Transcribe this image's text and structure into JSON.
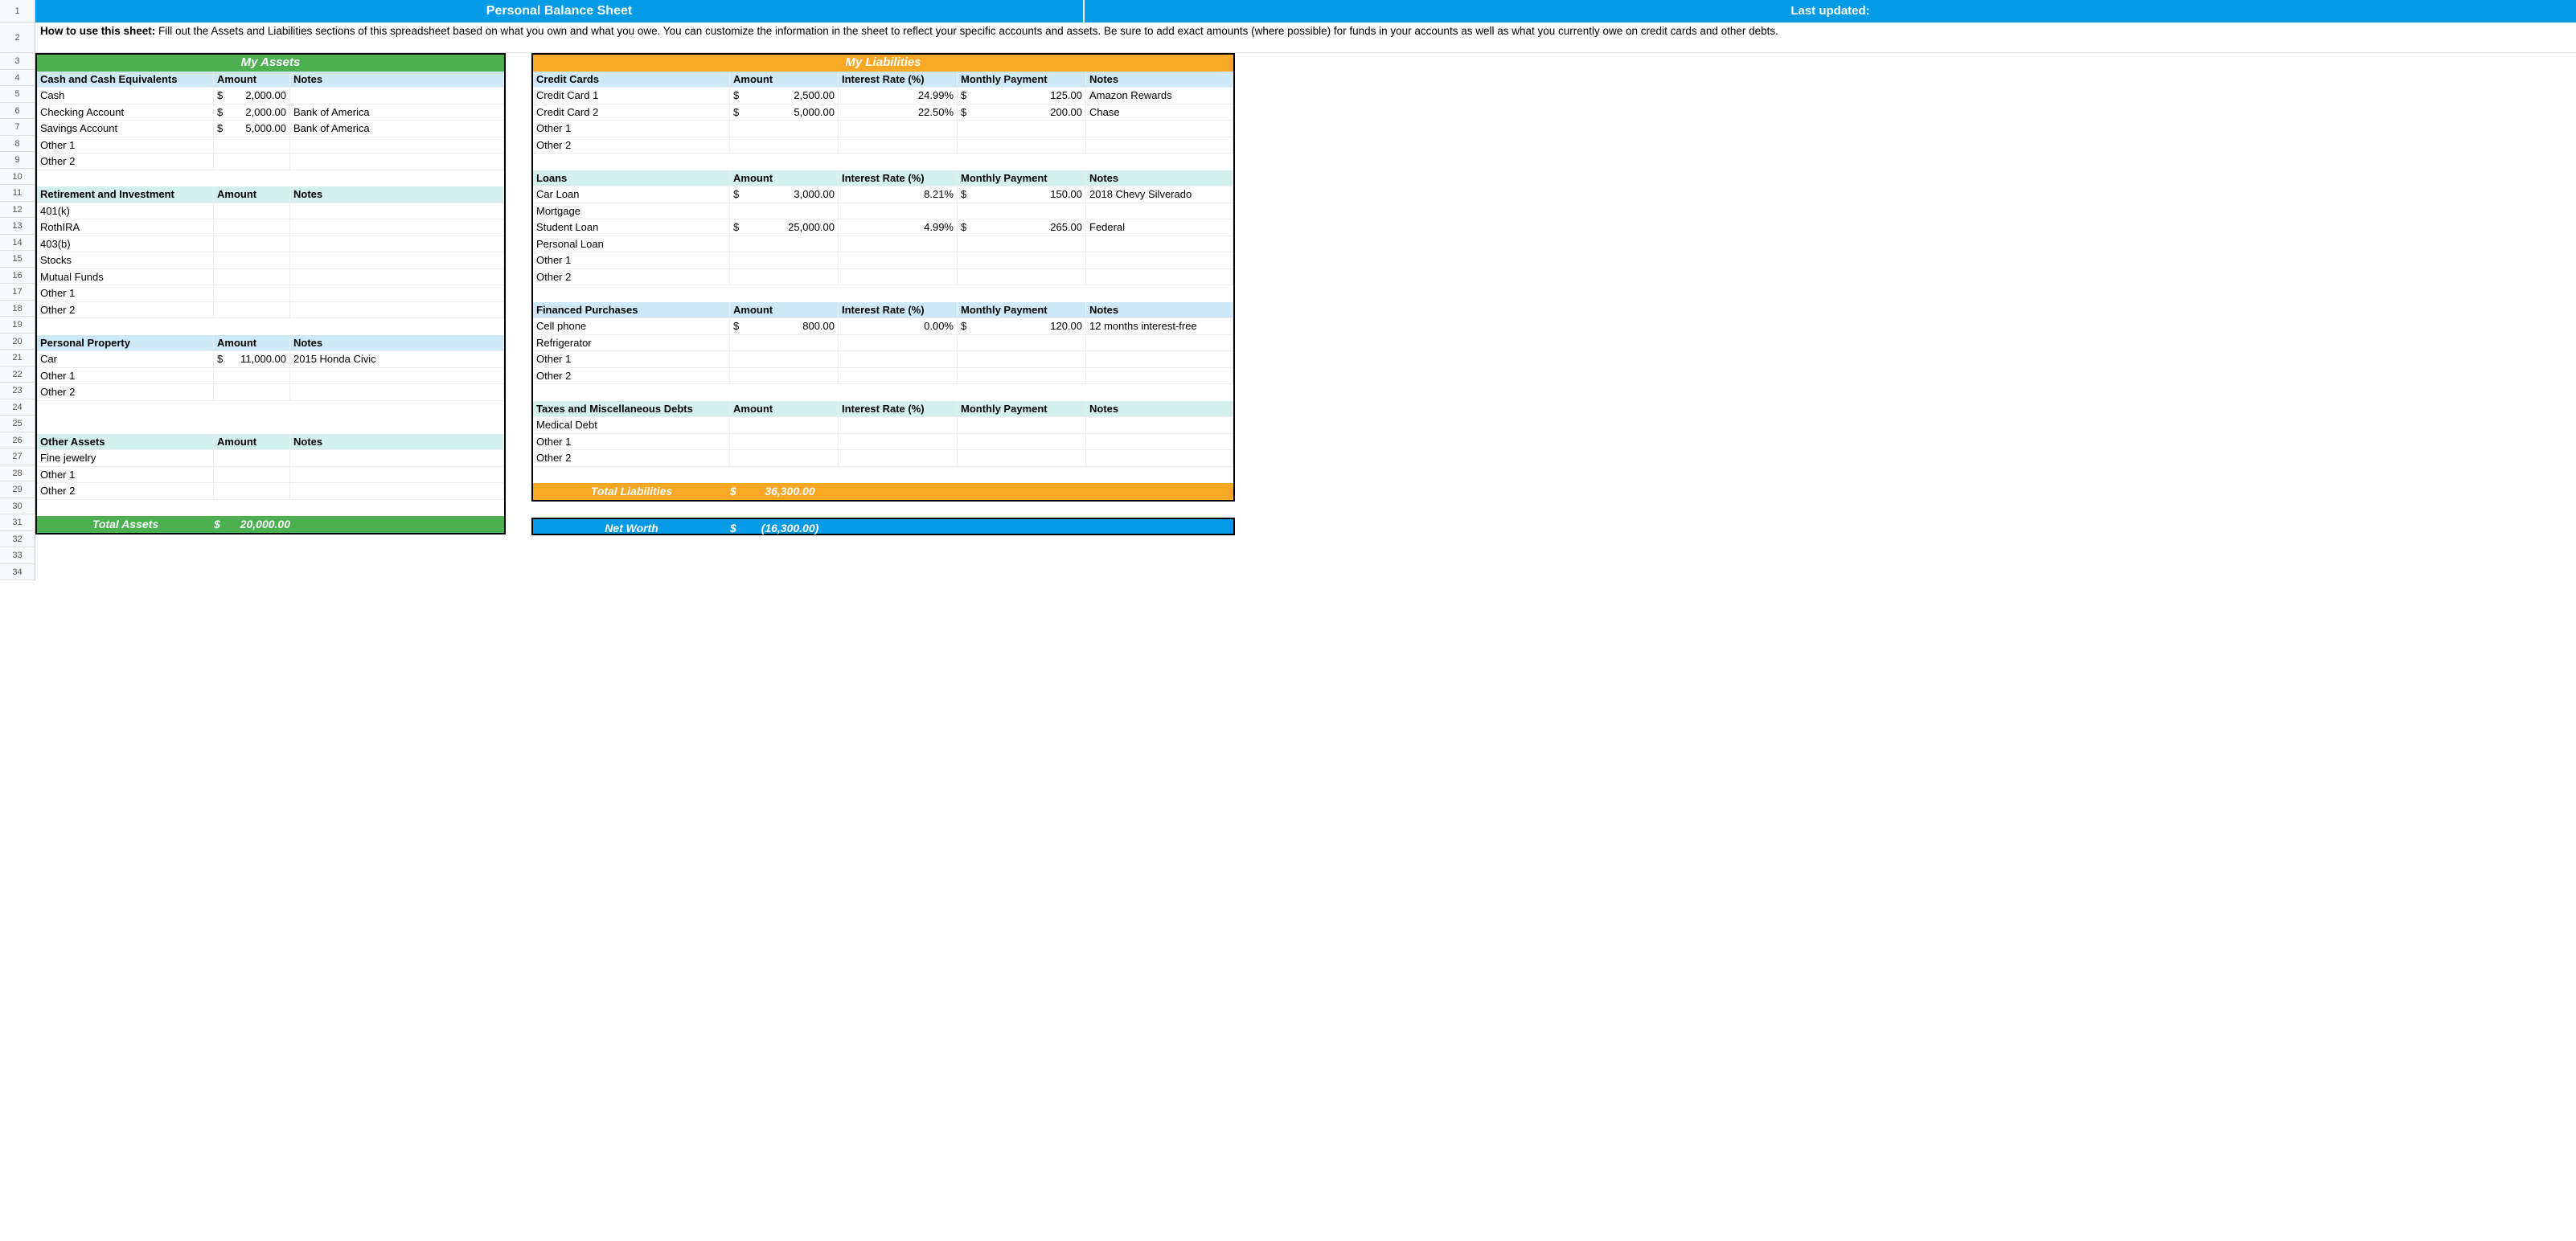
{
  "title": "Personal Balance Sheet",
  "lastUpdatedLabel": "Last updated:",
  "introBold": "How to use this sheet:",
  "introText": " Fill out the Assets and Liabilities sections of this spreadsheet based on what you own and what you owe. You can customize the information in the sheet to reflect your specific accounts and assets. Be sure to add exact amounts (where possible) for funds in your accounts as well as what you currently owe on credit cards and other debts.",
  "assetsTitle": "My Assets",
  "liabTitle": "My Liabilities",
  "colAmount": "Amount",
  "colNotes": "Notes",
  "colRate": "Interest Rate (%)",
  "colPay": "Monthly Payment",
  "assets": {
    "cash": {
      "header": "Cash and Cash Equivalents",
      "rows": [
        {
          "name": "Cash",
          "cur": "$",
          "amt": "2,000.00",
          "notes": ""
        },
        {
          "name": "Checking Account",
          "cur": "$",
          "amt": "2,000.00",
          "notes": "Bank of America"
        },
        {
          "name": "Savings Account",
          "cur": "$",
          "amt": "5,000.00",
          "notes": "Bank of America"
        },
        {
          "name": "Other 1",
          "cur": "",
          "amt": "",
          "notes": ""
        },
        {
          "name": "Other 2",
          "cur": "",
          "amt": "",
          "notes": ""
        }
      ]
    },
    "retire": {
      "header": "Retirement and Investment",
      "rows": [
        {
          "name": "401(k)",
          "cur": "",
          "amt": "",
          "notes": ""
        },
        {
          "name": "RothIRA",
          "cur": "",
          "amt": "",
          "notes": ""
        },
        {
          "name": "403(b)",
          "cur": "",
          "amt": "",
          "notes": ""
        },
        {
          "name": "Stocks",
          "cur": "",
          "amt": "",
          "notes": ""
        },
        {
          "name": "Mutual Funds",
          "cur": "",
          "amt": "",
          "notes": ""
        },
        {
          "name": "Other 1",
          "cur": "",
          "amt": "",
          "notes": ""
        },
        {
          "name": "Other 2",
          "cur": "",
          "amt": "",
          "notes": ""
        }
      ]
    },
    "prop": {
      "header": "Personal Property",
      "rows": [
        {
          "name": "Car",
          "cur": "$",
          "amt": "11,000.00",
          "notes": "2015 Honda Civic"
        },
        {
          "name": "Other 1",
          "cur": "",
          "amt": "",
          "notes": ""
        },
        {
          "name": "Other 2",
          "cur": "",
          "amt": "",
          "notes": ""
        }
      ]
    },
    "other": {
      "header": "Other Assets",
      "rows": [
        {
          "name": "Fine jewelry",
          "cur": "",
          "amt": "",
          "notes": ""
        },
        {
          "name": "Other 1",
          "cur": "",
          "amt": "",
          "notes": ""
        },
        {
          "name": "Other 2",
          "cur": "",
          "amt": "",
          "notes": ""
        }
      ]
    }
  },
  "liab": {
    "cc": {
      "header": "Credit Cards",
      "rows": [
        {
          "name": "Credit Card 1",
          "cur": "$",
          "amt": "2,500.00",
          "rate": "24.99%",
          "pcur": "$",
          "pay": "125.00",
          "notes": "Amazon Rewards"
        },
        {
          "name": "Credit Card 2",
          "cur": "$",
          "amt": "5,000.00",
          "rate": "22.50%",
          "pcur": "$",
          "pay": "200.00",
          "notes": "Chase"
        },
        {
          "name": "Other 1",
          "cur": "",
          "amt": "",
          "rate": "",
          "pcur": "",
          "pay": "",
          "notes": ""
        },
        {
          "name": "Other 2",
          "cur": "",
          "amt": "",
          "rate": "",
          "pcur": "",
          "pay": "",
          "notes": ""
        }
      ]
    },
    "loans": {
      "header": "Loans",
      "rows": [
        {
          "name": "Car Loan",
          "cur": "$",
          "amt": "3,000.00",
          "rate": "8.21%",
          "pcur": "$",
          "pay": "150.00",
          "notes": "2018 Chevy Silverado"
        },
        {
          "name": "Mortgage",
          "cur": "",
          "amt": "",
          "rate": "",
          "pcur": "",
          "pay": "",
          "notes": ""
        },
        {
          "name": "Student Loan",
          "cur": "$",
          "amt": "25,000.00",
          "rate": "4.99%",
          "pcur": "$",
          "pay": "265.00",
          "notes": "Federal"
        },
        {
          "name": "Personal Loan",
          "cur": "",
          "amt": "",
          "rate": "",
          "pcur": "",
          "pay": "",
          "notes": ""
        },
        {
          "name": "Other 1",
          "cur": "",
          "amt": "",
          "rate": "",
          "pcur": "",
          "pay": "",
          "notes": ""
        },
        {
          "name": "Other 2",
          "cur": "",
          "amt": "",
          "rate": "",
          "pcur": "",
          "pay": "",
          "notes": ""
        }
      ]
    },
    "fin": {
      "header": "Financed Purchases",
      "rows": [
        {
          "name": "Cell phone",
          "cur": "$",
          "amt": "800.00",
          "rate": "0.00%",
          "pcur": "$",
          "pay": "120.00",
          "notes": "12 months interest-free"
        },
        {
          "name": "Refrigerator",
          "cur": "",
          "amt": "",
          "rate": "",
          "pcur": "",
          "pay": "",
          "notes": ""
        },
        {
          "name": "Other 1",
          "cur": "",
          "amt": "",
          "rate": "",
          "pcur": "",
          "pay": "",
          "notes": ""
        },
        {
          "name": "Other 2",
          "cur": "",
          "amt": "",
          "rate": "",
          "pcur": "",
          "pay": "",
          "notes": ""
        }
      ]
    },
    "tax": {
      "header": "Taxes and Miscellaneous Debts",
      "rows": [
        {
          "name": "Medical Debt",
          "cur": "",
          "amt": "",
          "rate": "",
          "pcur": "",
          "pay": "",
          "notes": ""
        },
        {
          "name": "Other 1",
          "cur": "",
          "amt": "",
          "rate": "",
          "pcur": "",
          "pay": "",
          "notes": ""
        },
        {
          "name": "Other 2",
          "cur": "",
          "amt": "",
          "rate": "",
          "pcur": "",
          "pay": "",
          "notes": ""
        }
      ]
    }
  },
  "totalAssetsLabel": "Total Assets",
  "totalAssetsCur": "$",
  "totalAssetsVal": "20,000.00",
  "totalLiabLabel": "Total Liabilities",
  "totalLiabCur": "$",
  "totalLiabVal": "36,300.00",
  "netWorthLabel": "Net Worth",
  "netWorthCur": "$",
  "netWorthVal": "(16,300.00)"
}
